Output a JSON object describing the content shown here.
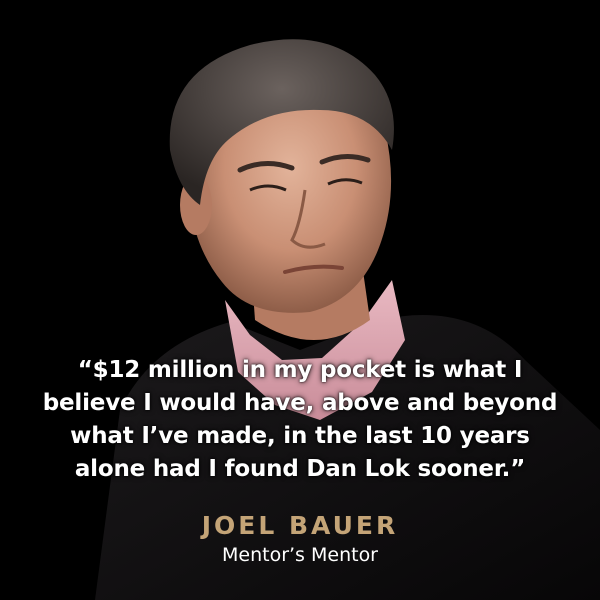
{
  "testimonial": {
    "quote_lines": [
      "“$12 million in my pocket is what I",
      "believe I would have, above and beyond",
      "what I’ve made, in the last 10 years",
      "alone had I found Dan Lok sooner.”"
    ],
    "name": "JOEL BAUER",
    "role": "Mentor’s Mentor"
  },
  "colors": {
    "background": "#000000",
    "quote_text": "#ffffff",
    "name_accent": "#c4a477",
    "role_text": "#ffffff"
  },
  "icons": {
    "portrait": "man-portrait-photo"
  }
}
